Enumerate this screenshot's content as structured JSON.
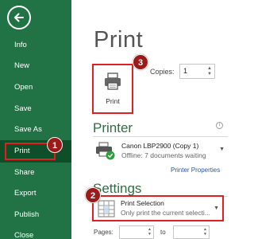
{
  "sidebar": {
    "items": [
      {
        "label": "Info"
      },
      {
        "label": "New"
      },
      {
        "label": "Open"
      },
      {
        "label": "Save"
      },
      {
        "label": "Save As"
      },
      {
        "label": "Print"
      },
      {
        "label": "Share"
      },
      {
        "label": "Export"
      },
      {
        "label": "Publish"
      },
      {
        "label": "Close"
      }
    ],
    "active": "Print"
  },
  "main": {
    "title": "Print",
    "print_button_label": "Print",
    "copies_label": "Copies:",
    "copies_value": "1",
    "printer_section_title": "Printer",
    "printer_name": "Canon LBP2900 (Copy 1)",
    "printer_status": "Offline: 7 documents waiting",
    "printer_properties_link": "Printer Properties",
    "settings_section_title": "Settings",
    "settings_selection_name": "Print Selection",
    "settings_selection_desc": "Only print the current selecti...",
    "pages_label": "Pages:",
    "to_label": "to",
    "pages_from": "",
    "pages_to": ""
  },
  "callouts": [
    "1",
    "2",
    "3"
  ],
  "colors": {
    "sidebar_bg": "#217346",
    "sidebar_active": "#0e4f2a",
    "accent_green": "#2e6e41",
    "highlight_red": "#e02020",
    "badge_bg": "#9b1a1a",
    "link_blue": "#2b579a"
  },
  "icons": [
    "back-arrow-icon",
    "printer-icon",
    "printer-status-icon",
    "check-icon",
    "print-selection-icon",
    "info-icon",
    "chevron-down-icon"
  ]
}
